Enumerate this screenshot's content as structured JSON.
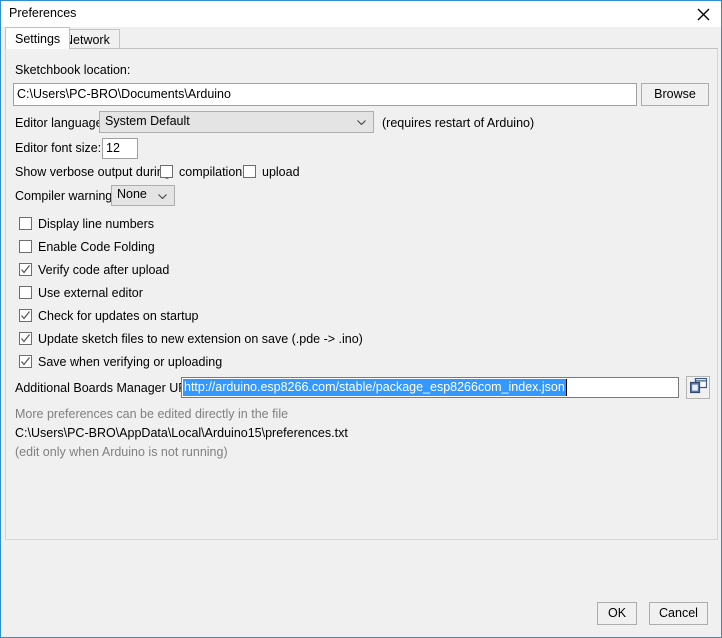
{
  "window": {
    "title": "Preferences",
    "close_icon": "close-icon",
    "accent_border": "#2e8fce"
  },
  "tabs": [
    {
      "id": "settings",
      "label": "Settings",
      "active": true
    },
    {
      "id": "network",
      "label": "Network",
      "active": false
    }
  ],
  "settings": {
    "sketchbook": {
      "label": "Sketchbook location:",
      "value": "C:\\Users\\PC-BRO\\Documents\\Arduino",
      "browse_label": "Browse"
    },
    "editor_language": {
      "label": "Editor language:",
      "value": "System Default",
      "note": "(requires restart of Arduino)"
    },
    "editor_font_size": {
      "label": "Editor font size:",
      "value": "12"
    },
    "verbose_output": {
      "label": "Show verbose output during:",
      "compilation_label": "compilation",
      "compilation_checked": false,
      "upload_label": "upload",
      "upload_checked": false
    },
    "compiler_warnings": {
      "label": "Compiler warnings:",
      "value": "None"
    },
    "checkboxes": [
      {
        "label": "Display line numbers",
        "checked": false
      },
      {
        "label": "Enable Code Folding",
        "checked": false
      },
      {
        "label": "Verify code after upload",
        "checked": true
      },
      {
        "label": "Use external editor",
        "checked": false
      },
      {
        "label": "Check for updates on startup",
        "checked": true
      },
      {
        "label": "Update sketch files to new extension on save (.pde -> .ino)",
        "checked": true
      },
      {
        "label": "Save when verifying or uploading",
        "checked": true
      }
    ],
    "boards_urls": {
      "label": "Additional Boards Manager URLs:",
      "value": "http://arduino.esp8266.com/stable/package_esp8266com_index.json",
      "selected": true,
      "selection_color": "#3399ff",
      "copy_icon": "windows-icon"
    },
    "footer": {
      "line1": "More preferences can be edited directly in the file",
      "line2": "C:\\Users\\PC-BRO\\AppData\\Local\\Arduino15\\preferences.txt",
      "line3": "(edit only when Arduino is not running)"
    }
  },
  "buttons": {
    "ok": "OK",
    "cancel": "Cancel"
  }
}
